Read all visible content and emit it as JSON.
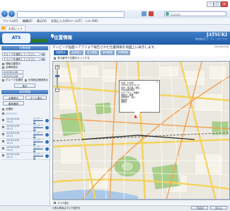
{
  "browser": {
    "back_icon": "back-arrow-icon",
    "forward_icon": "forward-arrow-icon",
    "search_placeholder": "Google",
    "menu": [
      "ファイル(F)",
      "編集(E)",
      "表示(V)",
      "お気に入り(A)",
      "ツール(T)",
      "ヘルプ(H)"
    ],
    "favorite_tab": "お気に入り"
  },
  "header": {
    "page_title": "位置情報",
    "brand": "JATSUKI",
    "brand_sub": "株式会社エイ・ティ・エス・ケイ"
  },
  "sidebar": {
    "location_header": "位置情報",
    "group_select": "グループを選択してください",
    "vehicle_select": "ドライバを選択してください",
    "checkbox_1": "運転位置表示",
    "checkbox_2": "全車両表示",
    "date_from": "2015/01/28",
    "date_to": "2015/01/28",
    "checkbox_3": "グループ全選択",
    "checkbox_4": "日時指定連続表示",
    "display_button": "表示",
    "vehicle_header": "車両情報",
    "tab_all": "全車表示",
    "tab_zoom": "ズーム表示",
    "filter_label": "車両選択",
    "select_all": "全選択",
    "vehicles": [
      {
        "date": "2015/01/28",
        "time": "15:11",
        "status": "エリア 一覧"
      },
      {
        "date": "2015/01/28",
        "time": "15:11",
        "status": "エリア 一覧"
      },
      {
        "date": "2015/01/28",
        "time": "15:11",
        "status": "エリア 一覧"
      },
      {
        "date": "2015/01/28",
        "time": "15:11",
        "status": "エリア 一覧"
      },
      {
        "date": "2015/01/28",
        "time": "15:11",
        "status": "エリア 一覧"
      },
      {
        "date": "2015/01/28",
        "time": "15:11",
        "status": "エリア 一覧"
      }
    ]
  },
  "main": {
    "subtitle": "マッピング画面へアプリより報告された位置情報を地図上に表示します。",
    "date_right": "2015/01/28",
    "tabs": [
      "地図表示",
      "全体表示",
      "走行履歴",
      "車両情報",
      "作業情報"
    ],
    "toolbar_text": "表示番号で位置をカットする",
    "popup_lines": [
      "位置：23台中",
      "2015/01/28 15:11",
      "住所：東京都…港区…",
      "方位/速度/時刻",
      "ステータス：作業中",
      "運転手：佐藤",
      "車両番号：品川",
      "運転者：",
      "[備考]"
    ],
    "footer_label": "マルチ表示",
    "status_text": "※表示車両はマルチ選択可",
    "footer_buttons": [
      "一覧表示",
      "閉じる"
    ]
  },
  "colors": {
    "header_blue": "#1f5aa6",
    "tab_active": "#2e6bb8",
    "tab_inactive": "#8aa8cf",
    "map_bg": "#e9e6dc",
    "park_green": "#a8cf8a",
    "road_yellow": "#f3d35a"
  }
}
